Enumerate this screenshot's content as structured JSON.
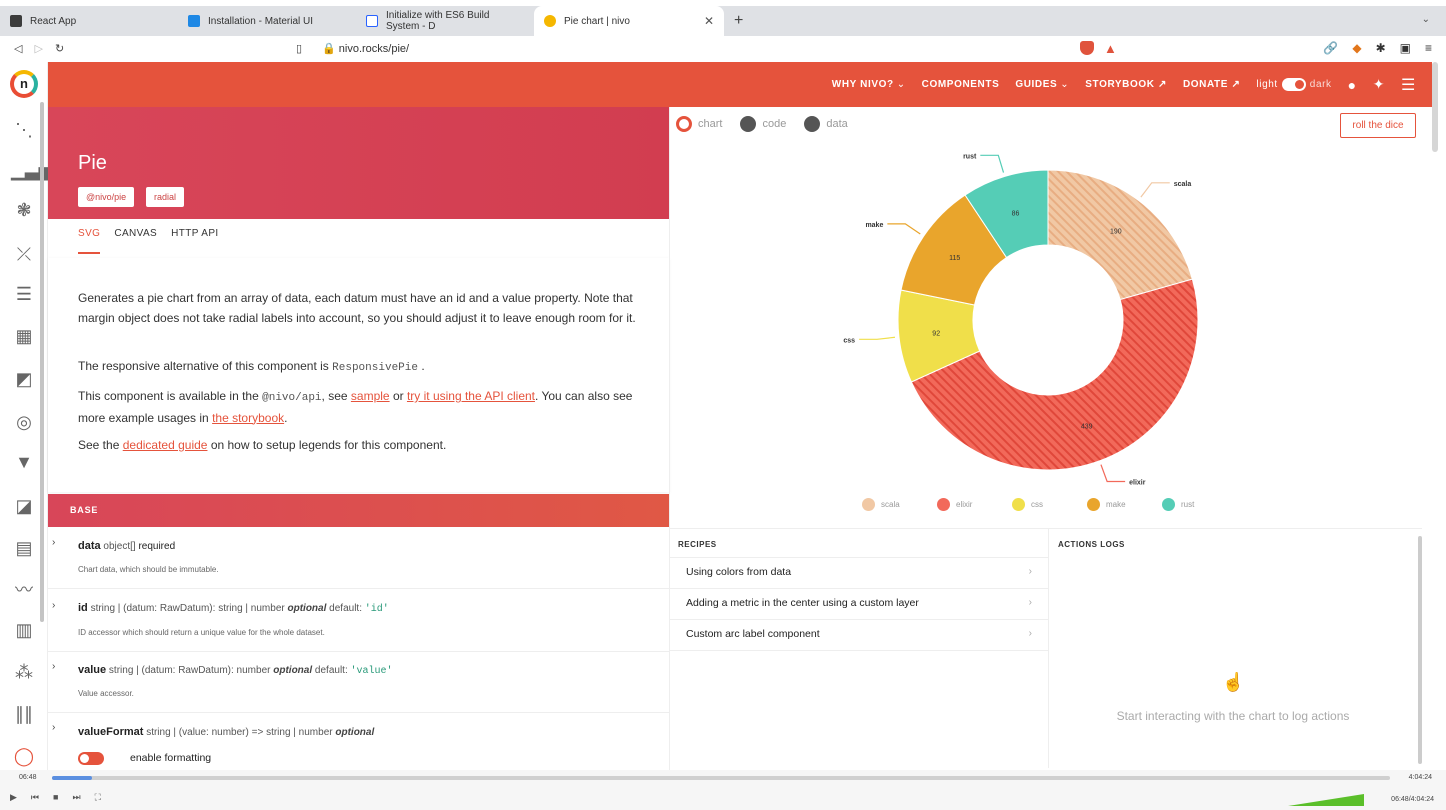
{
  "tabs": [
    {
      "label": "React App",
      "color": "#3c3c3c"
    },
    {
      "label": "Installation - Material UI",
      "color": "#1e88e5"
    },
    {
      "label": "Initialize with ES6 Build System - D",
      "color": "#2962ff"
    },
    {
      "label": "Pie chart | nivo",
      "color": "#f5b700"
    }
  ],
  "address": {
    "url": "nivo.rocks/pie/"
  },
  "topnav": {
    "items": [
      "WHY NIVO?",
      "COMPONENTS",
      "GUIDES",
      "STORYBOOK",
      "DONATE"
    ],
    "light": "light",
    "dark": "dark"
  },
  "logo": "n",
  "hero": {
    "title": "Pie",
    "pills": [
      "@nivo/pie",
      "radial"
    ]
  },
  "subtabs": [
    "SVG",
    "CANVAS",
    "HTTP API"
  ],
  "description": {
    "p1": "Generates a pie chart from an array of data, each datum must have an id and a value property. Note that margin object does not take radial labels into account, so you should adjust it to leave enough room for it.",
    "p2_pre": "The responsive alternative of this component is",
    "p2_code": "ResponsivePie",
    "p2_post": ".",
    "p3_pre": "This component is available in the",
    "p3_code": "@nivo/api",
    "p3_mid": ", see",
    "p3_link1": "sample",
    "p3_or": "or",
    "p3_link2": "try it using the API client",
    "p3_post": ". You can also see more example usages in",
    "p3_link3": "the storybook",
    "p3_end": ".",
    "p4_pre": "See the",
    "p4_link": "dedicated guide",
    "p4_post": "on how to setup legends for this component."
  },
  "base_label": "BASE",
  "props": [
    {
      "name": "data",
      "type": "object[]",
      "req": "required",
      "default_label": "",
      "default": "",
      "note": "Chart data, which should be immutable."
    },
    {
      "name": "id",
      "type": "string | (datum: RawDatum): string | number",
      "req": "optional",
      "default_label": "default:",
      "default": "'id'",
      "note": "ID accessor which should return a unique value for the whole dataset."
    },
    {
      "name": "value",
      "type": "string | (datum: RawDatum): number",
      "req": "optional",
      "default_label": "default:",
      "default": "'value'",
      "note": "Value accessor."
    },
    {
      "name": "valueFormat",
      "type": "string | (value: number) => string | number",
      "req": "optional",
      "default_label": "",
      "default": "",
      "note": ""
    }
  ],
  "enable_formatting": "enable formatting",
  "chart_panel": {
    "tabs": [
      "chart",
      "code",
      "data"
    ],
    "dice": "roll the dice"
  },
  "chart_data": {
    "type": "pie",
    "inner_radius_ratio": 0.5,
    "slices": [
      {
        "id": "scala",
        "value": 190,
        "color": "#f1c8a4"
      },
      {
        "id": "elixir",
        "value": 439,
        "color": "#f2695a"
      },
      {
        "id": "css",
        "value": 92,
        "color": "#f0df4a"
      },
      {
        "id": "make",
        "value": 115,
        "color": "#e9a52c"
      },
      {
        "id": "rust",
        "value": 86,
        "color": "#55cdb6"
      }
    ],
    "legend": [
      "scala",
      "elixir",
      "css",
      "make",
      "rust"
    ]
  },
  "recipes": {
    "title": "RECIPES",
    "items": [
      "Using colors from data",
      "Adding a metric in the center using a custom layer",
      "Custom arc label component"
    ]
  },
  "actions": {
    "title": "ACTIONS LOGS",
    "empty": "Start interacting with the chart to log actions"
  },
  "player": {
    "elapsed": "06:48",
    "total": "4:04:24",
    "clock": "06:48/4:04:24",
    "progress": 0.03
  }
}
